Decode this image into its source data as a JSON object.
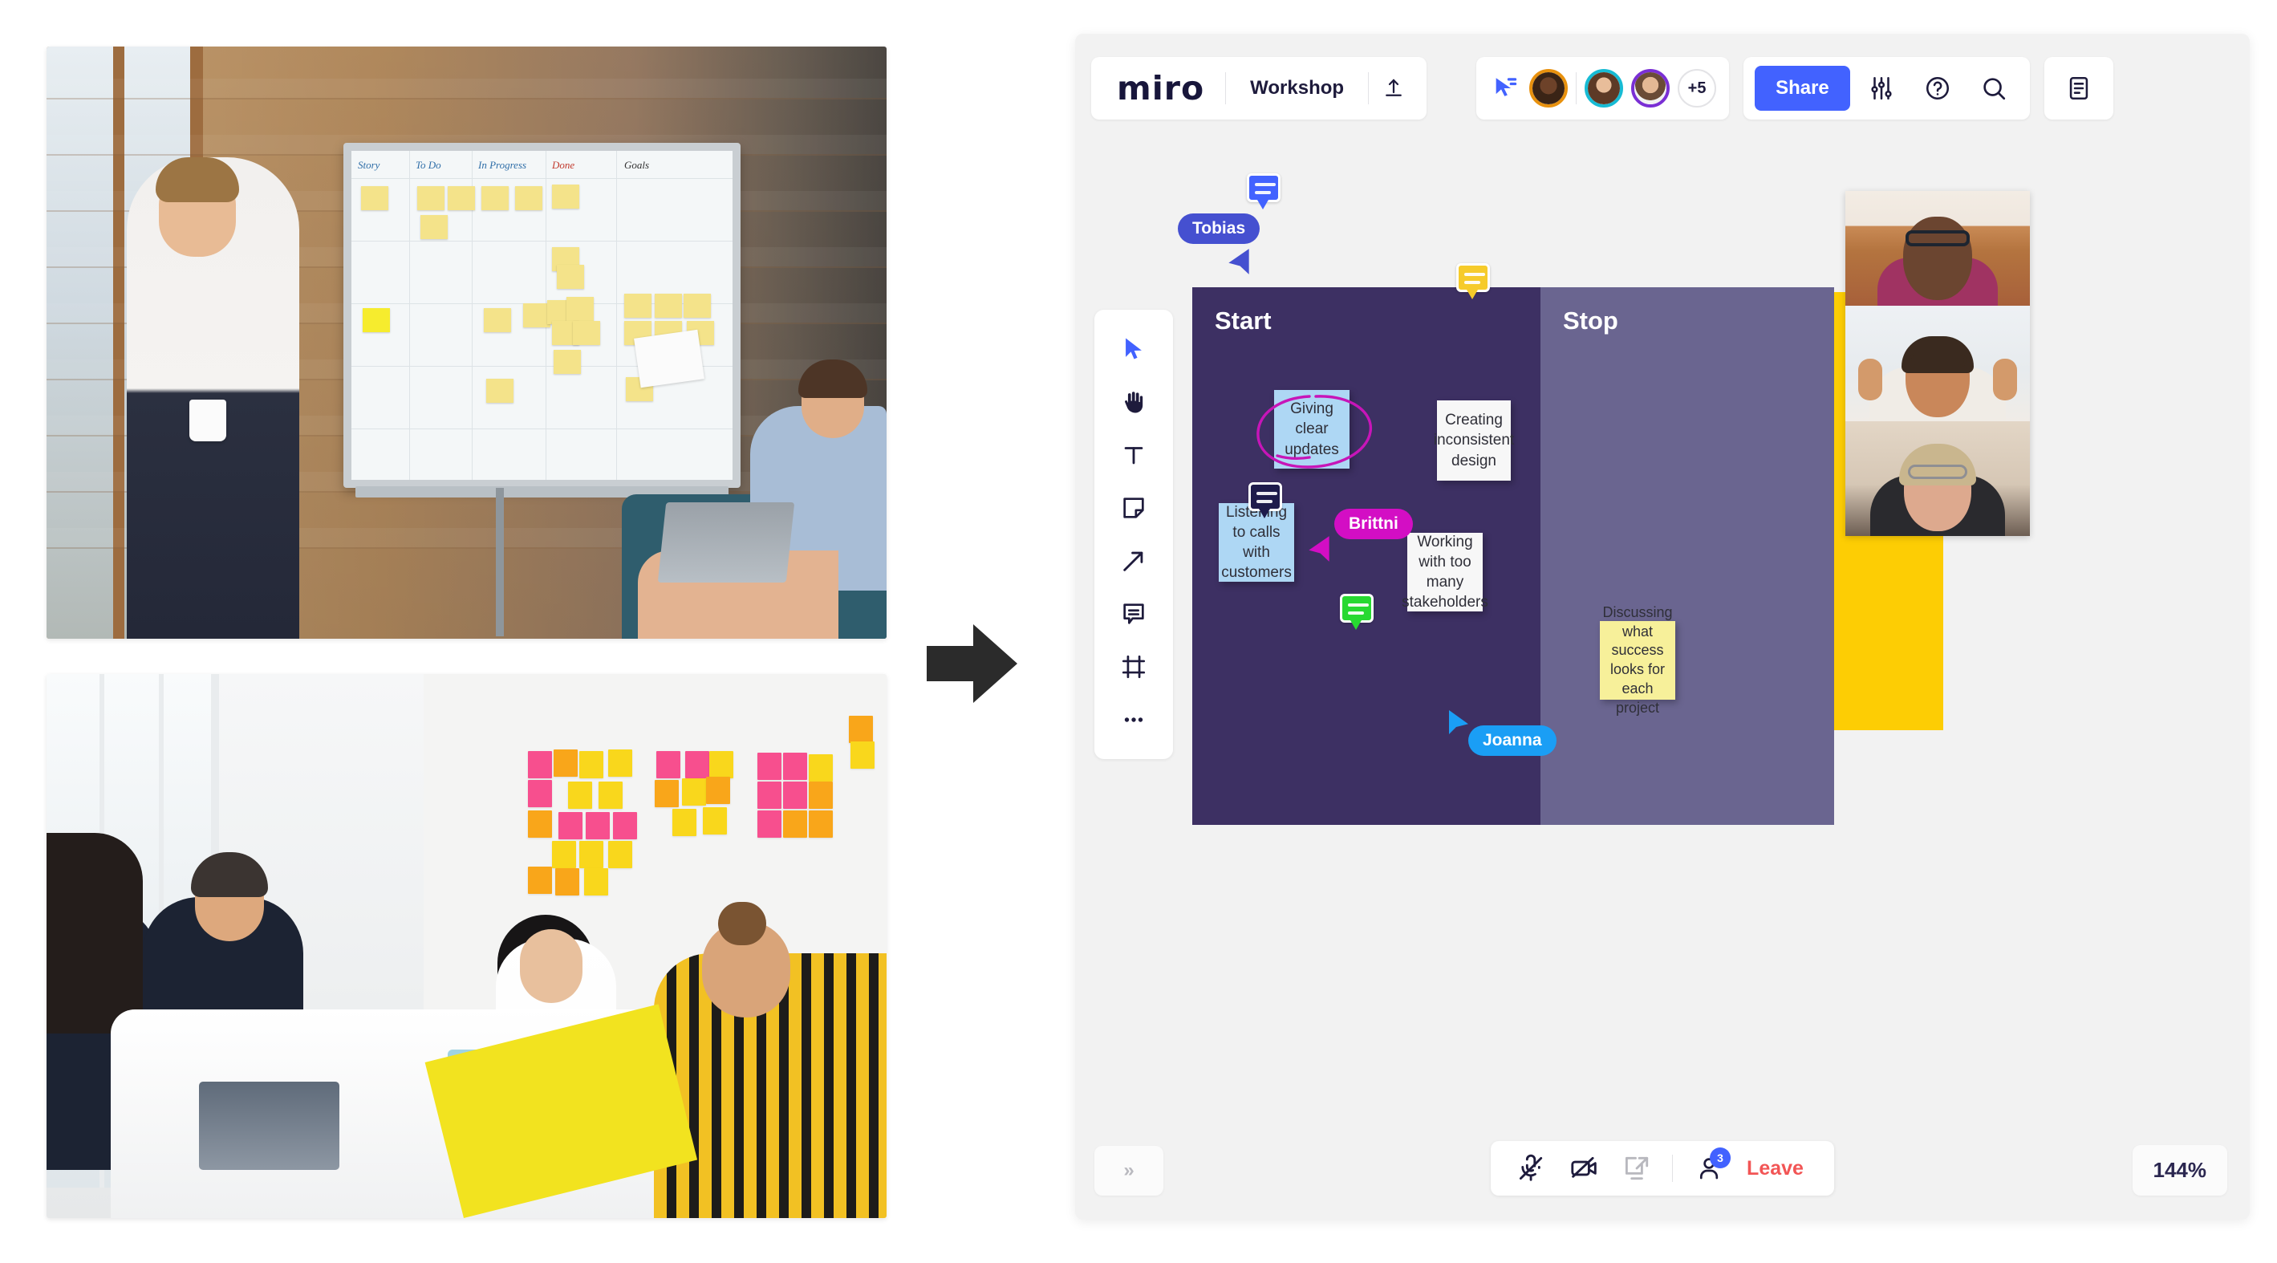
{
  "app": {
    "logo_text": "miro",
    "board_name": "Workshop",
    "upload_icon": "upload-icon",
    "cursor_share_icon": "cursor-share-icon",
    "overflow_avatars": "+5",
    "share_label": "Share",
    "settings_icon": "sliders-icon",
    "help_icon": "help-circle-icon",
    "search_icon": "search-icon",
    "panel_icon": "notes-panel-icon",
    "accent_color": "#4262ff"
  },
  "toolbar": {
    "items": [
      {
        "name": "select-tool",
        "icon": "cursor-arrow-icon",
        "active": true
      },
      {
        "name": "hand-tool",
        "icon": "hand-icon",
        "active": false
      },
      {
        "name": "text-tool",
        "icon": "text-t-icon",
        "active": false
      },
      {
        "name": "sticky-note-tool",
        "icon": "sticky-note-icon",
        "active": false
      },
      {
        "name": "arrow-tool",
        "icon": "arrow-diagonal-icon",
        "active": false
      },
      {
        "name": "comment-tool",
        "icon": "comment-icon",
        "active": false
      },
      {
        "name": "frame-tool",
        "icon": "frame-icon",
        "active": false
      },
      {
        "name": "more-tools",
        "icon": "ellipsis-icon",
        "active": false
      }
    ]
  },
  "board": {
    "frames": [
      {
        "title": "Start",
        "color": "#3d3063"
      },
      {
        "title": "Stop",
        "color": "#6a6590"
      }
    ],
    "yellow_frame_color": "#fdcd04",
    "sticky_notes": [
      {
        "text": "Giving clear updates",
        "color": "#aed7f4",
        "frame": "Start"
      },
      {
        "text": "Listening to calls with customers",
        "color": "#aed7f4",
        "frame": "Start"
      },
      {
        "text": "Creating inconsistent design",
        "color": "#f7f7f7",
        "frame": "Stop"
      },
      {
        "text": "Working with too many stakeholders",
        "color": "#f7f7f7",
        "frame": "Stop"
      },
      {
        "text": "Discussing what success looks for each project",
        "color": "#f7f09a",
        "frame": "Yellow"
      }
    ],
    "comments": [
      {
        "name": "comment-badge-blue",
        "color": "#4262ff"
      },
      {
        "name": "comment-badge-yellow",
        "color": "#f6cb2a"
      },
      {
        "name": "comment-badge-navy",
        "color": "#1e1b4b"
      },
      {
        "name": "comment-badge-green",
        "color": "#27d931"
      }
    ],
    "cursors": [
      {
        "label": "Tobias",
        "color": "#4550d0"
      },
      {
        "label": "Brittni",
        "color": "#d30ec4"
      },
      {
        "label": "Joanna",
        "color": "#1a9ef5"
      }
    ],
    "annotation": {
      "name": "magenta-circle-scribble",
      "color": "#c715b8"
    }
  },
  "video_panel": {
    "tiles": [
      {
        "name": "video-tile-participant-1"
      },
      {
        "name": "video-tile-participant-2"
      },
      {
        "name": "video-tile-participant-3"
      }
    ]
  },
  "footer": {
    "expand_label": "»",
    "mic_icon": "microphone-muted-icon",
    "camera_icon": "camera-off-icon",
    "screenshare_icon": "screen-share-icon",
    "people_icon": "person-icon",
    "people_count": "3",
    "leave_label": "Leave",
    "zoom_level": "144%"
  },
  "illustration": {
    "arrow_icon": "right-arrow-icon",
    "photo_top_alt": "workshop-photo-whiteboard",
    "photo_bottom_alt": "workshop-photo-sticky-wall",
    "whiteboard_columns": [
      "Story",
      "To Do",
      "In Progress",
      "Done",
      "Goals"
    ]
  }
}
